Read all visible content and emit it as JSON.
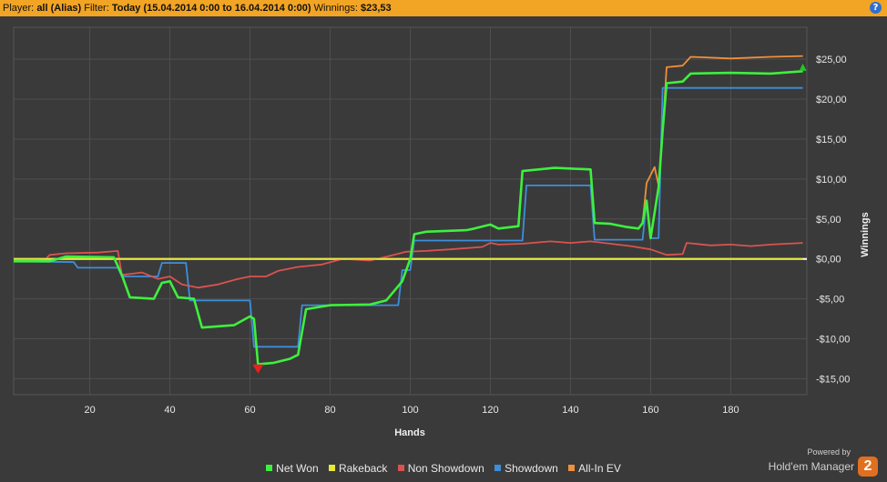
{
  "header": {
    "player_label": "Player:",
    "player_value": "all (Alias)",
    "filter_label": "Filter:",
    "filter_value": "Today (15.04.2014 0:00 to 16.04.2014 0:00)",
    "winnings_label": "Winnings:",
    "winnings_value": "$23,53",
    "help_icon": "?"
  },
  "brand": {
    "powered": "Powered by",
    "name": "Hold'em Manager",
    "badge": "2"
  },
  "colors": {
    "net_won": "#3ef03e",
    "rakeback": "#e8e83a",
    "non_showdown": "#d9534f",
    "showdown": "#3c8fdb",
    "all_in_ev": "#f0903a"
  },
  "chart_data": {
    "type": "line",
    "xlabel": "Hands",
    "ylabel": "Winnings",
    "xlim": [
      1,
      199
    ],
    "ylim": [
      -17,
      29
    ],
    "x_ticks": [
      20,
      40,
      60,
      80,
      100,
      120,
      140,
      160,
      180
    ],
    "y_ticks": [
      25,
      20,
      15,
      10,
      5,
      0,
      -5,
      -10,
      -15
    ],
    "y_tick_labels": [
      "$25,00",
      "$20,00",
      "$15,00",
      "$10,00",
      "$5,00",
      "$0,00",
      "-$5,00",
      "-$10,00",
      "-$15,00"
    ],
    "grid": true,
    "legend_position": "bottom",
    "series": [
      {
        "name": "All-In EV",
        "color": "#f0903a",
        "points": [
          [
            1,
            -0.3
          ],
          [
            10,
            -0.3
          ],
          [
            14,
            0.3
          ],
          [
            26,
            0.2
          ],
          [
            28,
            -2
          ],
          [
            30,
            -4.8
          ],
          [
            36,
            -5
          ],
          [
            38,
            -3
          ],
          [
            40,
            -2.8
          ],
          [
            42,
            -4.8
          ],
          [
            46,
            -5
          ],
          [
            48,
            -8.6
          ],
          [
            56,
            -8.3
          ],
          [
            60,
            -7.2
          ],
          [
            61,
            -7.5
          ],
          [
            62,
            -13.2
          ],
          [
            66,
            -13
          ],
          [
            70,
            -12.5
          ],
          [
            72,
            -12
          ],
          [
            74,
            -6.3
          ],
          [
            80,
            -5.8
          ],
          [
            90,
            -5.7
          ],
          [
            94,
            -5.2
          ],
          [
            98,
            -2.8
          ],
          [
            100,
            0
          ],
          [
            101,
            3.1
          ],
          [
            104,
            3.4
          ],
          [
            114,
            3.6
          ],
          [
            116,
            3.8
          ],
          [
            120,
            4.3
          ],
          [
            122,
            3.8
          ],
          [
            127,
            4.1
          ],
          [
            128,
            11.0
          ],
          [
            132,
            11.2
          ],
          [
            136,
            11.4
          ],
          [
            145,
            11.2
          ],
          [
            146,
            4.5
          ],
          [
            150,
            4.4
          ],
          [
            154,
            4.0
          ],
          [
            157,
            3.8
          ],
          [
            158,
            4.5
          ],
          [
            159,
            9.5
          ],
          [
            160,
            10.5
          ],
          [
            161,
            11.5
          ],
          [
            162,
            9.2
          ],
          [
            163,
            16
          ],
          [
            164,
            24.0
          ],
          [
            168,
            24.2
          ],
          [
            170,
            25.3
          ],
          [
            180,
            25.1
          ],
          [
            190,
            25.3
          ],
          [
            198,
            25.4
          ]
        ]
      },
      {
        "name": "Showdown",
        "color": "#3c8fdb",
        "points": [
          [
            1,
            -0.3
          ],
          [
            16,
            -0.4
          ],
          [
            17,
            -1.1
          ],
          [
            27,
            -1.1
          ],
          [
            28,
            -2.2
          ],
          [
            37,
            -2.2
          ],
          [
            38,
            -0.5
          ],
          [
            44,
            -0.5
          ],
          [
            45,
            -5.2
          ],
          [
            60,
            -5.2
          ],
          [
            61,
            -11
          ],
          [
            72,
            -11
          ],
          [
            73,
            -5.8
          ],
          [
            97,
            -5.8
          ],
          [
            98,
            -1.4
          ],
          [
            100,
            -1.4
          ],
          [
            101,
            2.3
          ],
          [
            128,
            2.3
          ],
          [
            129,
            9.2
          ],
          [
            145,
            9.2
          ],
          [
            146,
            2.4
          ],
          [
            158,
            2.4
          ],
          [
            159,
            7.3
          ],
          [
            160,
            2.6
          ],
          [
            162,
            2.6
          ],
          [
            163,
            21.4
          ],
          [
            198,
            21.4
          ]
        ]
      },
      {
        "name": "Non Showdown",
        "color": "#d9534f",
        "points": [
          [
            1,
            -0.1
          ],
          [
            9,
            0.0
          ],
          [
            10,
            0.5
          ],
          [
            14,
            0.7
          ],
          [
            22,
            0.8
          ],
          [
            27,
            1.0
          ],
          [
            28,
            -2.0
          ],
          [
            33,
            -1.7
          ],
          [
            37,
            -2.5
          ],
          [
            40,
            -2.2
          ],
          [
            43,
            -3.2
          ],
          [
            47,
            -3.6
          ],
          [
            52,
            -3.2
          ],
          [
            57,
            -2.5
          ],
          [
            60,
            -2.2
          ],
          [
            64,
            -2.2
          ],
          [
            67,
            -1.5
          ],
          [
            72,
            -1.0
          ],
          [
            78,
            -0.7
          ],
          [
            83,
            0.0
          ],
          [
            90,
            -0.2
          ],
          [
            95,
            0.4
          ],
          [
            99,
            0.9
          ],
          [
            104,
            1.0
          ],
          [
            110,
            1.2
          ],
          [
            118,
            1.5
          ],
          [
            120,
            2.0
          ],
          [
            122,
            1.8
          ],
          [
            128,
            1.9
          ],
          [
            135,
            2.2
          ],
          [
            140,
            2.0
          ],
          [
            145,
            2.2
          ],
          [
            150,
            1.9
          ],
          [
            155,
            1.6
          ],
          [
            160,
            1.2
          ],
          [
            164,
            0.5
          ],
          [
            168,
            0.6
          ],
          [
            169,
            2.0
          ],
          [
            175,
            1.7
          ],
          [
            180,
            1.8
          ],
          [
            185,
            1.6
          ],
          [
            190,
            1.8
          ],
          [
            198,
            2.0
          ]
        ]
      },
      {
        "name": "Rakeback",
        "color": "#e8e83a",
        "points": [
          [
            1,
            0
          ],
          [
            198,
            0
          ]
        ]
      },
      {
        "name": "Net Won",
        "color": "#3ef03e",
        "points": [
          [
            1,
            -0.3
          ],
          [
            10,
            -0.3
          ],
          [
            14,
            0.3
          ],
          [
            26,
            0.2
          ],
          [
            28,
            -2
          ],
          [
            30,
            -4.8
          ],
          [
            36,
            -5
          ],
          [
            38,
            -3
          ],
          [
            40,
            -2.8
          ],
          [
            42,
            -4.8
          ],
          [
            46,
            -5
          ],
          [
            48,
            -8.6
          ],
          [
            56,
            -8.3
          ],
          [
            60,
            -7.2
          ],
          [
            61,
            -7.5
          ],
          [
            62,
            -13.2
          ],
          [
            66,
            -13
          ],
          [
            70,
            -12.5
          ],
          [
            72,
            -12
          ],
          [
            74,
            -6.3
          ],
          [
            80,
            -5.8
          ],
          [
            90,
            -5.7
          ],
          [
            94,
            -5.2
          ],
          [
            98,
            -2.8
          ],
          [
            100,
            0
          ],
          [
            101,
            3.1
          ],
          [
            104,
            3.4
          ],
          [
            114,
            3.6
          ],
          [
            116,
            3.8
          ],
          [
            120,
            4.3
          ],
          [
            122,
            3.8
          ],
          [
            127,
            4.1
          ],
          [
            128,
            11.0
          ],
          [
            132,
            11.2
          ],
          [
            136,
            11.4
          ],
          [
            145,
            11.2
          ],
          [
            146,
            4.5
          ],
          [
            150,
            4.4
          ],
          [
            154,
            4.0
          ],
          [
            157,
            3.8
          ],
          [
            158,
            4.5
          ],
          [
            159,
            7.3
          ],
          [
            160,
            2.6
          ],
          [
            162,
            9.0
          ],
          [
            163,
            16
          ],
          [
            164,
            22.0
          ],
          [
            168,
            22.2
          ],
          [
            170,
            23.2
          ],
          [
            180,
            23.3
          ],
          [
            190,
            23.2
          ],
          [
            198,
            23.5
          ]
        ]
      }
    ],
    "markers": [
      {
        "type": "min",
        "x": 62,
        "y": -13.9,
        "color": "#e82020"
      },
      {
        "type": "max",
        "x": 198,
        "y": 24.0,
        "color": "#29c229"
      }
    ]
  },
  "legend": [
    {
      "label": "Net Won",
      "color": "#3ef03e"
    },
    {
      "label": "Rakeback",
      "color": "#e8e83a"
    },
    {
      "label": "Non Showdown",
      "color": "#d9534f"
    },
    {
      "label": "Showdown",
      "color": "#3c8fdb"
    },
    {
      "label": "All-In EV",
      "color": "#f0903a"
    }
  ]
}
